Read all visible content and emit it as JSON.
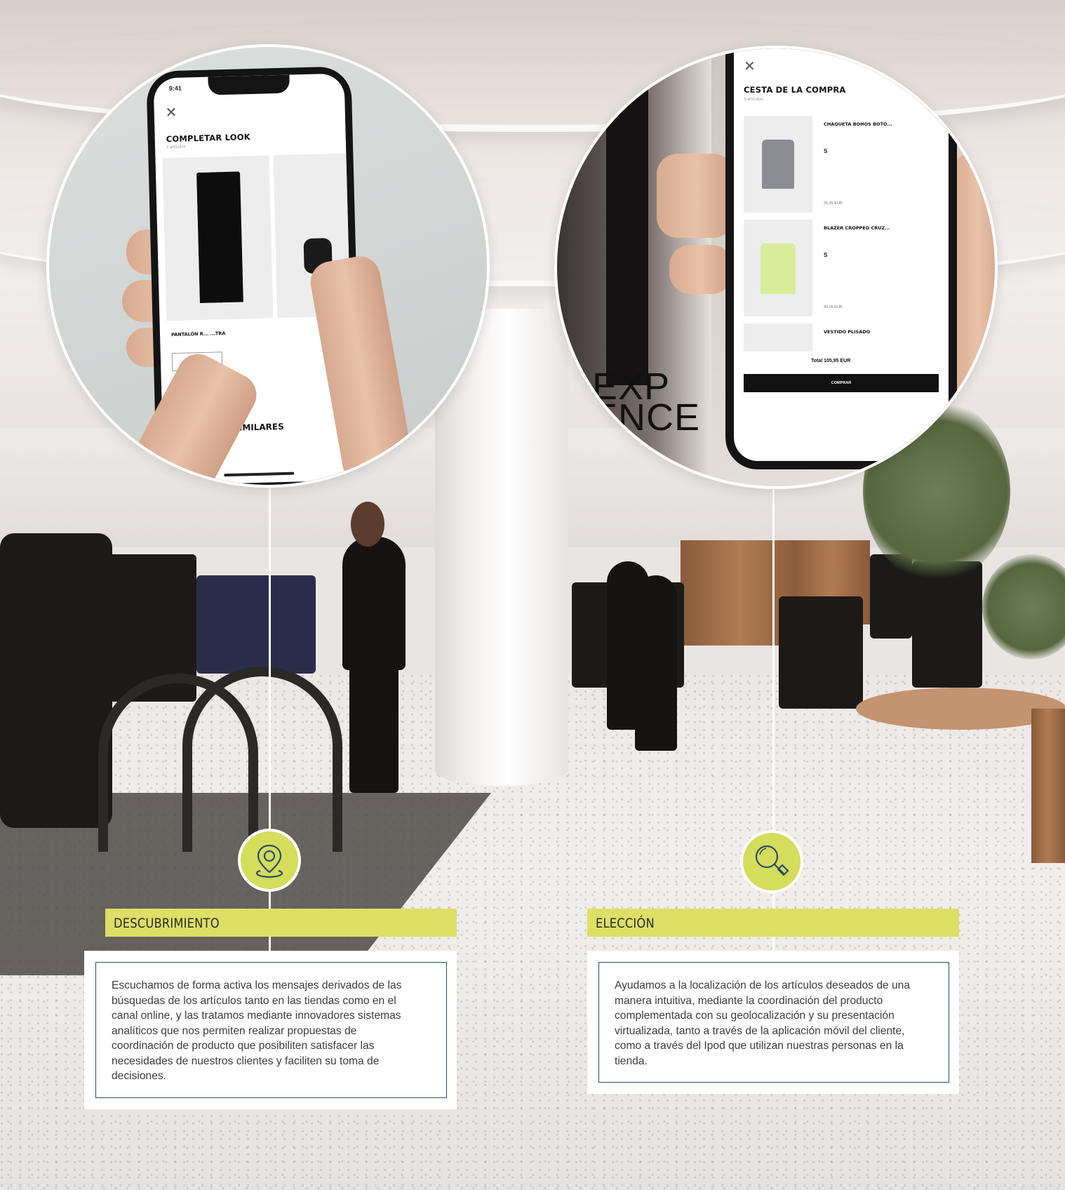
{
  "left_phone": {
    "status_time": "9:41",
    "title": "COMPLETAR LOOK",
    "subtitle": "2 artículos",
    "product_name": "PANTALÓN R... ...TRA",
    "similar_heading": "...ÓS SIMILARES"
  },
  "right_phone": {
    "title": "CESTA DE LA COMPRA",
    "subtitle": "3 artículos",
    "items": [
      {
        "name": "CHAQUETA BOHOS BOTÓ...",
        "size": "S",
        "price": "25,95 EUR"
      },
      {
        "name": "BLAZER CROPPED CRUZ...",
        "size": "S",
        "price": "49,95 EUR"
      },
      {
        "name": "VESTIDO PLISADO"
      }
    ],
    "total": "Total 105,95 EUR",
    "buy_button": "COMPRAR",
    "background_sign": "EXP\nENCE"
  },
  "sections": [
    {
      "label": "DESCUBRIMIENTO",
      "icon": "location-pin-icon",
      "text": "Escuchamos de forma activa los mensajes derivados de las búsquedas de los artículos tanto en las tiendas como en el canal online,  y las tratamos mediante innovadores sistemas analíticos que nos permiten realizar propuestas de coordinación de producto que posibiliten satisfacer las necesidades de nuestros clientes y faciliten su toma de decisiones."
    },
    {
      "label": "ELECCIÓN",
      "icon": "magnifier-icon",
      "text": "Ayudamos a la localización de los artículos deseados de una manera intuitiva, mediante la coordinación del producto complementada con su geolocalización y su presentación virtualizada, tanto a través de la aplicación móvil del cliente, como a través del Ipod que utilizan nuestras personas en la tienda."
    }
  ],
  "colors": {
    "accent": "#DDE065",
    "badge": "#D4DD5C",
    "card_border": "#2B4D6D",
    "text": "#3C3C3C"
  }
}
